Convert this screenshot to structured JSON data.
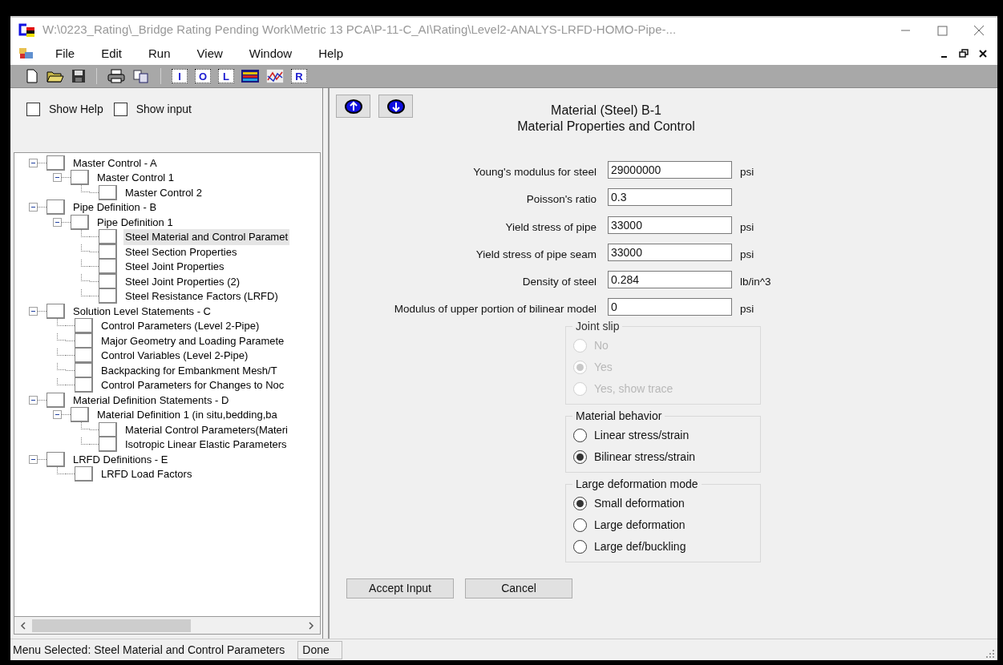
{
  "window": {
    "title": "W:\\0223_Rating\\_Bridge Rating Pending Work\\Metric 13 PCA\\P-11-C_AI\\Rating\\Level2-ANALYS-LRFD-HOMO-Pipe-..."
  },
  "menu": [
    "File",
    "Edit",
    "Run",
    "View",
    "Window",
    "Help"
  ],
  "toolbar": [
    {
      "kind": "new"
    },
    {
      "kind": "open"
    },
    {
      "kind": "save"
    },
    {
      "kind": "separator"
    },
    {
      "kind": "print"
    },
    {
      "kind": "copy"
    },
    {
      "kind": "separator"
    },
    {
      "kind": "letter",
      "glyph": "I"
    },
    {
      "kind": "letter",
      "glyph": "O"
    },
    {
      "kind": "letter",
      "glyph": "L"
    },
    {
      "kind": "grid"
    },
    {
      "kind": "chart"
    },
    {
      "kind": "letter",
      "glyph": "R"
    }
  ],
  "options": [
    {
      "label": "Show Help",
      "checked": false
    },
    {
      "label": "Show input",
      "checked": false
    }
  ],
  "tree": [
    {
      "label": "Master Control - A",
      "selected": false,
      "expanded": true,
      "children": [
        {
          "label": "Master Control 1",
          "selected": false,
          "expanded": true,
          "children": [
            {
              "label": "Master Control 2",
              "selected": false
            }
          ]
        }
      ]
    },
    {
      "label": "Pipe Definition - B",
      "selected": false,
      "expanded": true,
      "children": [
        {
          "label": "Pipe Definition 1",
          "selected": false,
          "expanded": true,
          "children": [
            {
              "label": "Steel Material and Control Paramet",
              "selected": true
            },
            {
              "label": "Steel Section Properties",
              "selected": false
            },
            {
              "label": "Steel Joint Properties",
              "selected": false
            },
            {
              "label": "Steel Joint Properties (2)",
              "selected": false
            },
            {
              "label": "Steel Resistance Factors (LRFD)",
              "selected": false
            }
          ]
        }
      ]
    },
    {
      "label": "Solution Level Statements - C",
      "selected": false,
      "expanded": true,
      "children": [
        {
          "label": "Control Parameters (Level 2-Pipe)",
          "selected": false
        },
        {
          "label": "Major Geometry and Loading Paramete",
          "selected": false
        },
        {
          "label": "Control Variables (Level 2-Pipe)",
          "selected": false
        },
        {
          "label": "Backpacking for Embankment Mesh/T",
          "selected": false
        },
        {
          "label": "Control Parameters for Changes to Noc",
          "selected": false
        }
      ]
    },
    {
      "label": "Material Definition Statements - D",
      "selected": false,
      "expanded": true,
      "children": [
        {
          "label": "Material Definition 1 (in situ,bedding,ba",
          "selected": false,
          "expanded": true,
          "children": [
            {
              "label": "Material Control Parameters(Materi",
              "selected": false
            },
            {
              "label": "Isotropic Linear Elastic Parameters",
              "selected": false
            }
          ]
        }
      ]
    },
    {
      "label": "LRFD Definitions - E",
      "selected": false,
      "expanded": true,
      "children": [
        {
          "label": "LRFD Load Factors",
          "selected": false
        }
      ]
    }
  ],
  "form": {
    "title": "Material (Steel) B-1",
    "subtitle": "Material Properties and Control",
    "fields": [
      {
        "label": "Young's modulus for steel",
        "value": "29000000",
        "unit": "psi"
      },
      {
        "label": "Poisson's ratio",
        "value": "0.3"
      },
      {
        "label": "Yield stress of pipe",
        "value": "33000",
        "unit": "psi"
      },
      {
        "label": "Yield stress of pipe seam",
        "value": "33000",
        "unit": "psi"
      },
      {
        "label": "Density of steel",
        "value": "0.284",
        "unit": "lb/in^3"
      },
      {
        "label": "Modulus of upper portion of bilinear model",
        "value": "0",
        "unit": "psi"
      }
    ],
    "groups": [
      {
        "title": "Joint slip",
        "disabled": true,
        "options": [
          {
            "label": "No",
            "selected": false
          },
          {
            "label": "Yes",
            "selected": true
          },
          {
            "label": "Yes, show trace",
            "selected": false
          }
        ]
      },
      {
        "title": "Material behavior",
        "disabled": false,
        "options": [
          {
            "label": "Linear stress/strain",
            "selected": false
          },
          {
            "label": "Bilinear stress/strain",
            "selected": true
          }
        ]
      },
      {
        "title": "Large deformation mode",
        "disabled": false,
        "options": [
          {
            "label": "Small deformation",
            "selected": true
          },
          {
            "label": "Large deformation",
            "selected": false
          },
          {
            "label": "Large def/buckling",
            "selected": false
          }
        ]
      }
    ],
    "buttons": [
      "Accept Input",
      "Cancel"
    ]
  },
  "status_bar": [
    "Menu Selected: Steel Material and Control Parameters",
    "Done"
  ]
}
